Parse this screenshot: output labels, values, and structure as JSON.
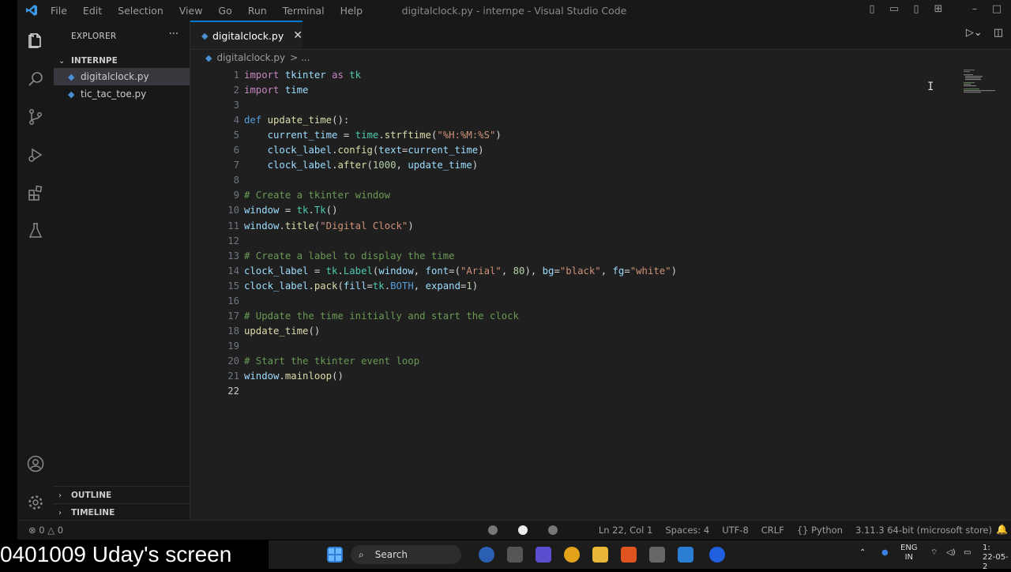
{
  "titlebar": {
    "menu": [
      "File",
      "Edit",
      "Selection",
      "View",
      "Go",
      "Run",
      "Terminal",
      "Help"
    ],
    "window_title": "digitalclock.py - internpe - Visual Studio Code"
  },
  "sidebar": {
    "header": "EXPLORER",
    "folder": "INTERNPE",
    "files": [
      "digitalclock.py",
      "tic_tac_toe.py"
    ],
    "outline": "OUTLINE",
    "timeline": "TIMELINE"
  },
  "tab": {
    "label": "digitalclock.py"
  },
  "breadcrumb": {
    "file": "digitalclock.py",
    "rest": "> ..."
  },
  "editor": {
    "line_numbers": [
      "1",
      "2",
      "3",
      "4",
      "5",
      "6",
      "7",
      "8",
      "9",
      "10",
      "11",
      "12",
      "13",
      "14",
      "15",
      "16",
      "17",
      "18",
      "19",
      "20",
      "21",
      "22"
    ],
    "current_line": 22,
    "code_lines": [
      "import tkinter as tk",
      "import time",
      "",
      "def update_time():",
      "    current_time = time.strftime(\"%H:%M:%S\")",
      "    clock_label.config(text=current_time)",
      "    clock_label.after(1000, update_time)",
      "",
      "# Create a tkinter window",
      "window = tk.Tk()",
      "window.title(\"Digital Clock\")",
      "",
      "# Create a label to display the time",
      "clock_label = tk.Label(window, font=(\"Arial\", 80), bg=\"black\", fg=\"white\")",
      "clock_label.pack(fill=tk.BOTH, expand=1)",
      "",
      "# Update the time initially and start the clock",
      "update_time()",
      "",
      "# Start the tkinter event loop",
      "window.mainloop()",
      ""
    ]
  },
  "statusbar": {
    "problems": "⊗ 0 △ 0",
    "position": "Ln 22, Col 1",
    "spaces": "Spaces: 4",
    "encoding": "UTF-8",
    "eol": "CRLF",
    "language": "Python",
    "interpreter": "3.11.3 64-bit (microsoft store)"
  },
  "taskbar": {
    "search": "Search",
    "lang_top": "ENG",
    "lang_bottom": "IN",
    "clock_time": "1:",
    "clock_date": "22-05-2"
  },
  "overlay": {
    "screen_label": "0401009 Uday's screen"
  },
  "colors": {
    "accent": "#0078d4",
    "editor_bg": "#1f1f1f",
    "chrome_bg": "#181818"
  }
}
